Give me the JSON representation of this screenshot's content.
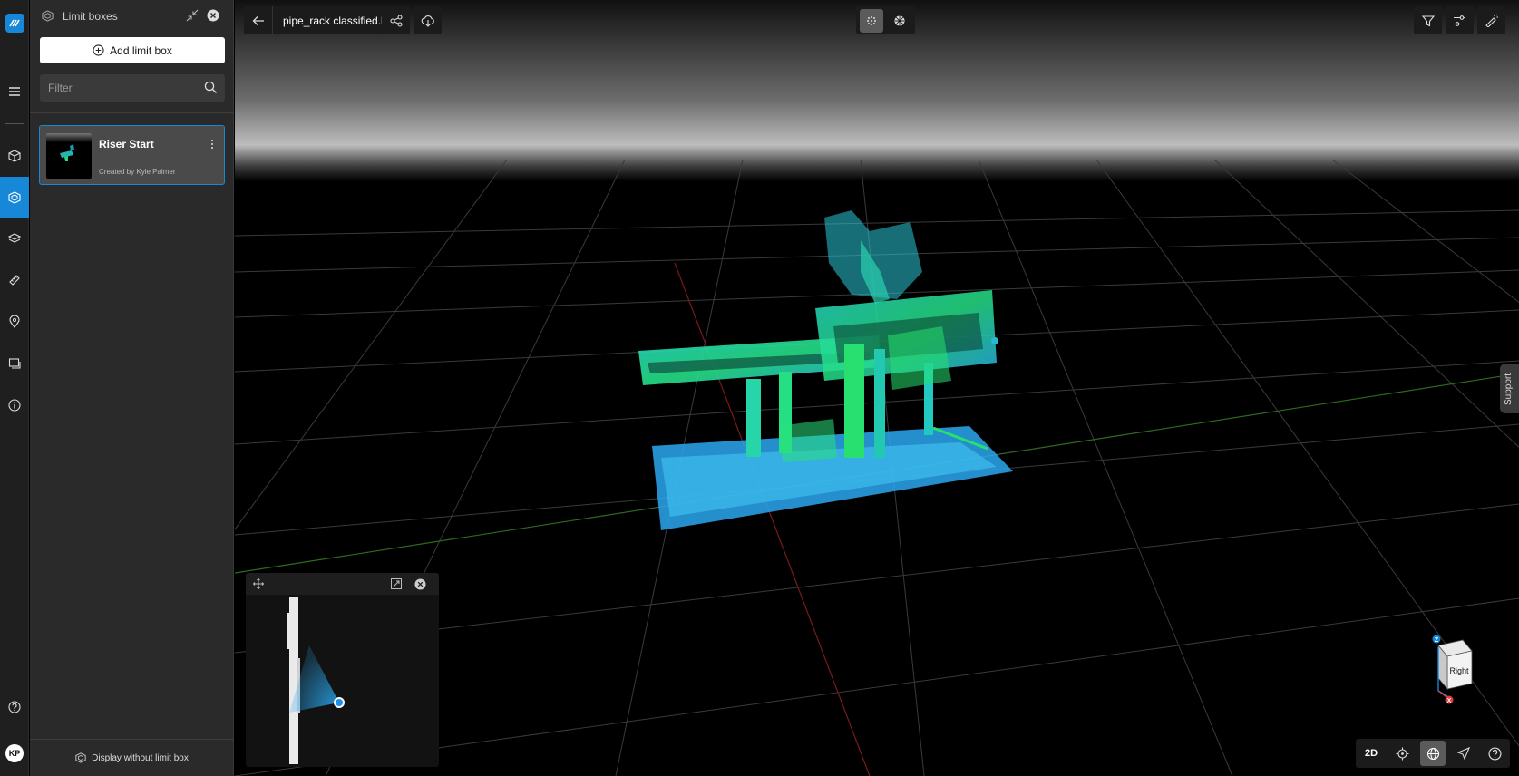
{
  "app": {
    "user_initials": "KP"
  },
  "panel": {
    "title": "Limit boxes",
    "add_button_label": "Add limit box",
    "filter_placeholder": "Filter",
    "items": [
      {
        "name": "Riser Start",
        "creator": "Created by Kyle Palmer"
      }
    ],
    "footer_label": "Display without limit box"
  },
  "toolbar": {
    "filename": "pipe_rack classified.lgsx"
  },
  "support_label": "Support",
  "navcube": {
    "face_label": "Right",
    "axis_z": "Z",
    "axis_x": "X"
  },
  "bottom_toolbar": {
    "mode_2d_label": "2D"
  },
  "colors": {
    "accent": "#1787d8",
    "point_cloud_cyan": "#1fd6d0",
    "point_cloud_green": "#26e07a",
    "point_cloud_blue": "#2aa8f0"
  }
}
